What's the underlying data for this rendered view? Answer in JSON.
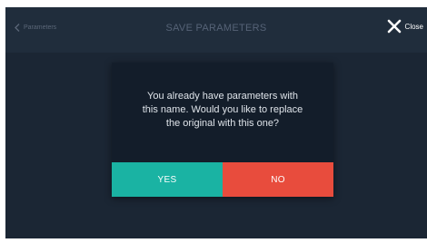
{
  "header": {
    "back_label": "Parameters",
    "title": "SAVE PARAMETERS",
    "close_label": "Close"
  },
  "dialog": {
    "message_line1": "You already have parameters with",
    "message_line2": "this name. Would you like to replace",
    "message_line3": "the original with this one?",
    "yes_label": "YES",
    "no_label": "NO"
  },
  "colors": {
    "background": "#1b2634",
    "header": "#202d3c",
    "dialog": "#131d2a",
    "yes": "#1ab3a3",
    "no": "#e84c3d"
  },
  "icons": {
    "back": "chevron-left-icon",
    "close": "close-icon"
  }
}
